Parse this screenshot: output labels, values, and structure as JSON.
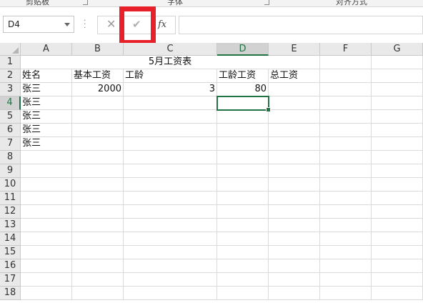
{
  "ribbon": {
    "groups": [
      "剪贴板",
      "字体",
      "对齐方式"
    ]
  },
  "formula_bar": {
    "name_box": "D4",
    "fx_label": "fx",
    "formula": ""
  },
  "columns": [
    "A",
    "B",
    "C",
    "D",
    "E",
    "F",
    "G"
  ],
  "rows": [
    "1",
    "2",
    "3",
    "4",
    "5",
    "6",
    "7",
    "8",
    "9",
    "10",
    "11",
    "12",
    "13",
    "14",
    "15",
    "16",
    "17",
    "18"
  ],
  "cells": {
    "title": "5月工资表",
    "A2": "姓名",
    "B2": "基本工资",
    "C2": "工龄",
    "D2": "工龄工资",
    "E2": "总工资",
    "A3": "张三",
    "B3": "2000",
    "C3": "3",
    "D3": "80",
    "A4": "张三",
    "A5": "张三",
    "A6": "张三",
    "A7": "张三"
  },
  "selected_cell": "D4",
  "colors": {
    "accent": "#217346",
    "highlight": "#e8202a"
  }
}
